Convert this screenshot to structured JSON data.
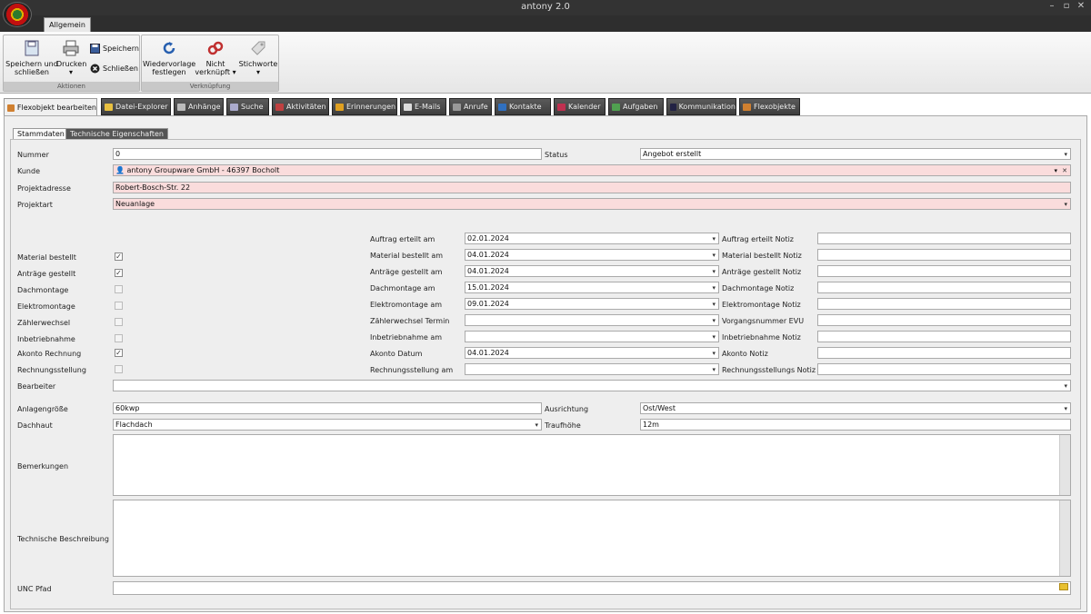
{
  "window": {
    "title": "antony 2.0"
  },
  "ribbon": {
    "tab": "Allgemein",
    "groups": [
      {
        "label": "Aktionen",
        "save_close": "Speichern und schließen",
        "print": "Drucken",
        "save": "Speichern",
        "close": "Schließen"
      },
      {
        "label": "Verknüpfung",
        "resubmit": "Wiedervorlage festlegen",
        "unlinked": "Nicht verknüpft",
        "keywords": "Stichworte"
      }
    ]
  },
  "tabs": [
    "Flexobjekt bearbeiten",
    "Datei-Explorer",
    "Anhänge",
    "Suche",
    "Aktivitäten",
    "Erinnerungen",
    "E-Mails",
    "Anrufe",
    "Kontakte",
    "Kalender",
    "Aufgaben",
    "Kommunikation",
    "Flexobjekte"
  ],
  "subtabs": [
    "Stammdaten",
    "Technische Eigenschaften"
  ],
  "form": {
    "nummer_label": "Nummer",
    "nummer": "0",
    "status_label": "Status",
    "status": "Angebot erstellt",
    "kunde_label": "Kunde",
    "kunde": "antony Groupware GmbH - 46397 Bocholt",
    "projektadresse_label": "Projektadresse",
    "projektadresse": "Robert-Bosch-Str. 22",
    "projektart_label": "Projektart",
    "projektart": "Neuanlage",
    "auftrag_label": "Auftrag erteilt am",
    "auftrag_date": "02.01.2024",
    "auftrag_note_label": "Auftrag erteilt Notiz",
    "rows": [
      {
        "check_label": "Material bestellt",
        "checked": true,
        "date_label": "Material bestellt am",
        "date": "04.01.2024",
        "note_label": "Material bestellt Notiz"
      },
      {
        "check_label": "Anträge gestellt",
        "checked": true,
        "date_label": "Anträge gestellt am",
        "date": "04.01.2024",
        "note_label": "Anträge gestellt Notiz"
      },
      {
        "check_label": "Dachmontage",
        "checked": false,
        "date_label": "Dachmontage am",
        "date": "15.01.2024",
        "note_label": "Dachmontage Notiz"
      },
      {
        "check_label": "Elektromontage",
        "checked": false,
        "date_label": "Elektromontage am",
        "date": "09.01.2024",
        "note_label": "Elektromontage Notiz"
      },
      {
        "check_label": "Zählerwechsel",
        "checked": false,
        "date_label": "Zählerwechsel Termin",
        "date": "",
        "note_label": "Vorgangsnummer EVU"
      },
      {
        "check_label": "Inbetriebnahme",
        "checked": false,
        "date_label": "Inbetriebnahme am",
        "date": "",
        "note_label": "Inbetriebnahme Notiz"
      },
      {
        "check_label": "Akonto Rechnung",
        "checked": true,
        "date_label": "Akonto Datum",
        "date": "04.01.2024",
        "note_label": "Akonto Notiz"
      },
      {
        "check_label": "Rechnungsstellung",
        "checked": false,
        "date_label": "Rechnungsstellung am",
        "date": "",
        "note_label": "Rechnungsstellungs Notiz"
      }
    ],
    "bearbeiter_label": "Bearbeiter",
    "bearbeiter": "",
    "anlagengroesse_label": "Anlagengröße",
    "anlagengroesse": "60kwp",
    "ausrichtung_label": "Ausrichtung",
    "ausrichtung": "Ost/West",
    "dachhaut_label": "Dachhaut",
    "dachhaut": "Flachdach",
    "traufhoehe_label": "Traufhöhe",
    "traufhoehe": "12m",
    "bemerkungen_label": "Bemerkungen",
    "technische_label": "Technische Beschreibung",
    "unc_label": "UNC Pfad",
    "unc": ""
  }
}
